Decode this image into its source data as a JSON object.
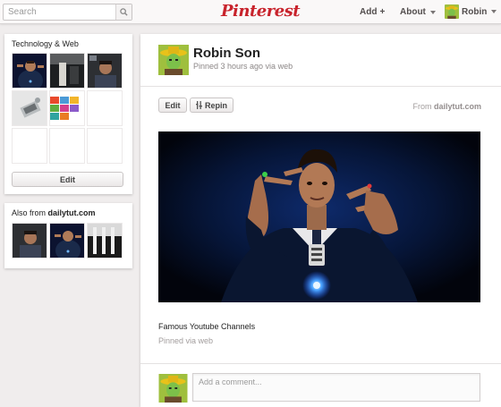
{
  "header": {
    "search_placeholder": "Search",
    "logo": "Pinterest",
    "add_label": "Add",
    "add_plus": "+",
    "about_label": "About",
    "user_label": "Robin",
    "brand_color": "#c8232c"
  },
  "board": {
    "title": "Technology & Web",
    "edit_label": "Edit",
    "thumbnails": [
      "gesture-photo-blue",
      "dark-photo-figure",
      "man-portrait-photo",
      "gadget-photo",
      "colorful-grid-photo",
      "empty",
      "empty",
      "empty",
      "empty"
    ]
  },
  "also_from": {
    "prefix": "Also from",
    "source": "dailytut.com",
    "thumbnails": [
      "man-portrait-photo",
      "gesture-photo-blue",
      "stage-photo"
    ]
  },
  "pin": {
    "user_name": "Robin Son",
    "meta": "Pinned 3 hours ago via web",
    "edit_label": "Edit",
    "repin_label": "Repin",
    "from_prefix": "From",
    "from_source": "dailytut.com",
    "caption": "Famous Youtube Channels",
    "pinned_via": "Pinned via web",
    "comment_placeholder": "Add a comment..."
  }
}
